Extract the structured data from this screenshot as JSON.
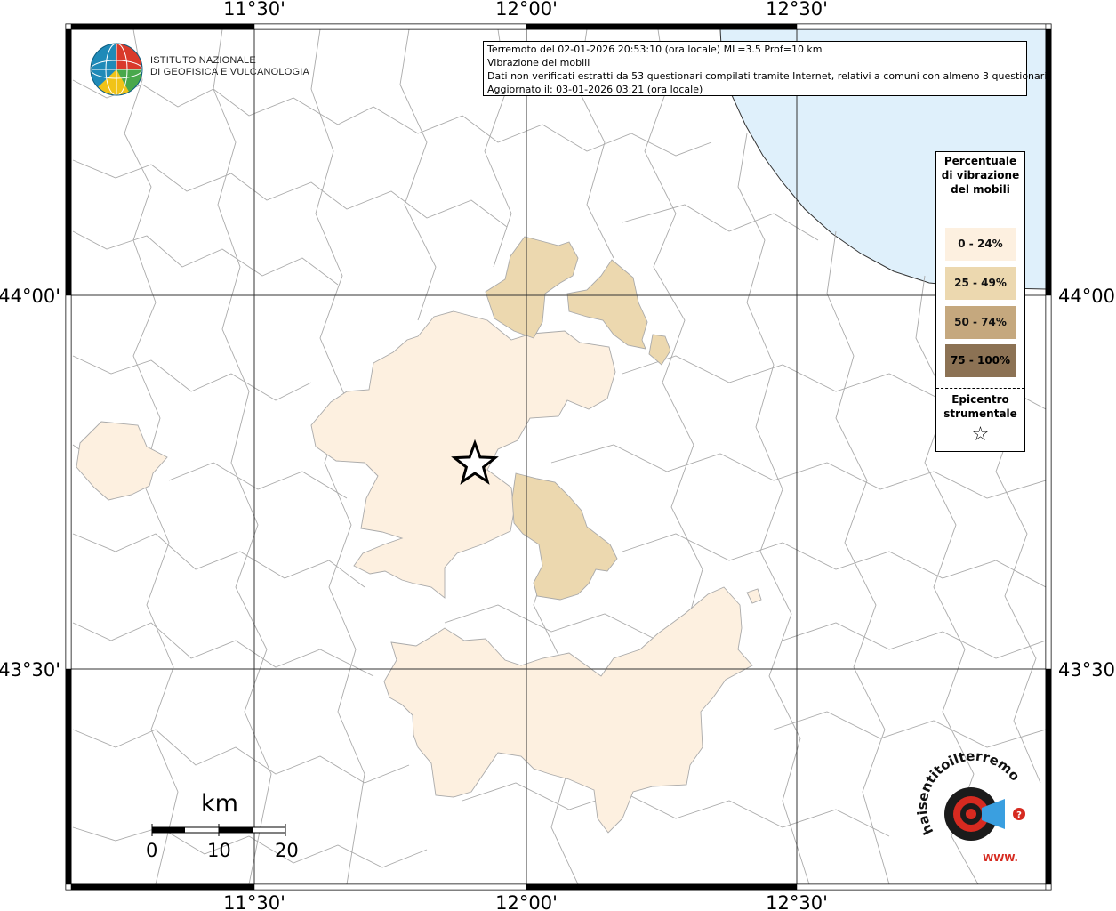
{
  "map": {
    "graticule": {
      "lon_labels_top": [
        "11°30'",
        "12°00'",
        "12°30'"
      ],
      "lon_labels_bottom": [
        "11°30'",
        "12°00'",
        "12°30'"
      ],
      "lat_labels_left": [
        "44°00'",
        "43°30'"
      ],
      "lat_labels_right": [
        "44°00'",
        "43°30'"
      ]
    },
    "sea_color": "#dff0fb",
    "background_color": "#ffffff",
    "epicenter_marker": "star"
  },
  "organization": {
    "line1": "Istituto Nazionale",
    "line2": "di Geofisica e Vulcanologia",
    "logo_icon": "ingv-globe-logo"
  },
  "info": {
    "line1": "Terremoto del 02-01-2026 20:53:10 (ora locale) ML=3.5 Prof=10 km",
    "line2": "Vibrazione dei mobili",
    "line3": "Dati non verificati estratti da 53 questionari compilati tramite Internet, relativi a comuni con almeno 3 questionari.",
    "line4": "Aggiornato il: 03-01-2026 03:21 (ora locale)"
  },
  "legend": {
    "title": "Percentuale di vibrazione del mobili",
    "classes": [
      {
        "label": "0 - 24%",
        "color": "#fdf0e0"
      },
      {
        "label": "25 - 49%",
        "color": "#ecd8af"
      },
      {
        "label": "50 - 74%",
        "color": "#c5a87e"
      },
      {
        "label": "75 - 100%",
        "color": "#8c7254"
      }
    ],
    "epicenter_label": "Epicentro strumentale",
    "epicenter_symbol": "☆"
  },
  "scale_bar": {
    "unit": "km",
    "ticks": [
      "0",
      "10",
      "20"
    ]
  },
  "brand": {
    "text": "haisentitoilterremoto.it",
    "url_text": "WWW.",
    "logo_icon": "haisentito-target-logo"
  }
}
